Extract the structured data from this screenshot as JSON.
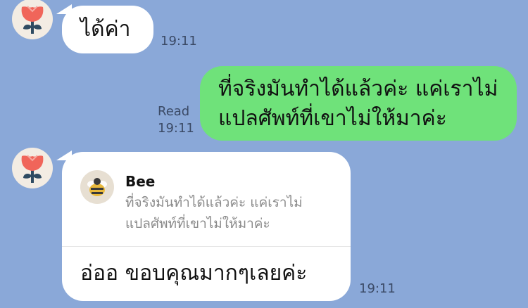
{
  "chat": {
    "message1": {
      "text": "ได้ค่า",
      "time": "19:11",
      "avatar_icon": "flower-icon"
    },
    "message2": {
      "line1": "ที่จริงมันทำได้แล้วค่ะ แค่เราไม่",
      "line2": "แปลศัพท์ที่เขาไม่ให้มาค่ะ",
      "read_label": "Read",
      "time": "19:11"
    },
    "message3": {
      "reply_name": "Bee",
      "reply_line1": "ที่จริงมันทำได้แล้วค่ะ แค่เราไม่",
      "reply_line2": "แปลศัพท์ที่เขาไม่ให้มาค่ะ",
      "text": "อ่ออ ขอบคุณมากๆเลยค่ะ",
      "time": "19:11",
      "avatar_icon": "flower-icon",
      "reply_avatar_icon": "bee-icon"
    }
  },
  "colors": {
    "background": "#8aa8d8",
    "incoming_bubble": "#ffffff",
    "outgoing_bubble": "#6fe27a",
    "flower_red": "#f0655a",
    "flower_stem": "#2f4b62"
  }
}
